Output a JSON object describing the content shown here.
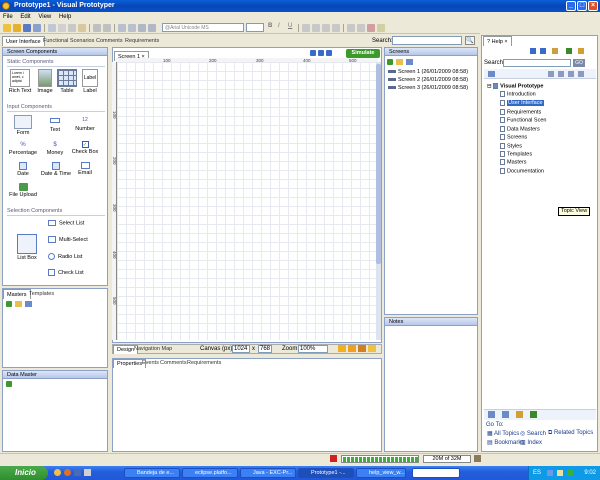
{
  "window": {
    "title": "Prototype1 - Visual Prototyper"
  },
  "menu": [
    "File",
    "Edit",
    "View",
    "Help"
  ],
  "toolbar": {
    "font_name": "@Arial Unicode MS",
    "bold": "B",
    "italic": "I",
    "underline": "U"
  },
  "top_tabs": [
    "User Interface",
    "Functional Scenarios",
    "Comments",
    "Requirements"
  ],
  "search": {
    "label": "Search:",
    "value": "",
    "button": "🔍"
  },
  "screen_components": {
    "title": "Screen Components",
    "static_title": "Static Components",
    "static": [
      {
        "label": "Rich Text",
        "preview": "Lorem i amet, c adipisi"
      },
      {
        "label": "Image"
      },
      {
        "label": "Table"
      },
      {
        "label": "Label",
        "preview": "Label"
      }
    ],
    "input_title": "Input Components",
    "inputs": [
      "Form",
      "Text",
      "Number",
      "Percentage",
      "Money",
      "Check Box",
      "Date",
      "Date & Time",
      "Email",
      "File Upload"
    ],
    "selection_title": "Selection Components",
    "selection": [
      "Select List",
      "Multi-Select",
      "List Box",
      "Radio List",
      "Check List"
    ]
  },
  "masters_tabs": [
    "Masters",
    "Templates"
  ],
  "data_master": {
    "title": "Data Master"
  },
  "canvas_tab": {
    "label": "Screen 1",
    "simulate": "Simulate"
  },
  "ruler": {
    "top": [
      "100",
      "200",
      "300",
      "400",
      "500"
    ],
    "left": [
      "100",
      "200",
      "300",
      "400",
      "500"
    ]
  },
  "design_bar": {
    "tabs": [
      "Design",
      "Navigation Map"
    ],
    "canvas_label": "Canvas (px):",
    "width": "1024",
    "times": "x",
    "height": "768",
    "zoom_label": "Zoom:",
    "zoom_value": "100%"
  },
  "properties_tabs": [
    "Properties",
    "Events",
    "Comments",
    "Requirements"
  ],
  "screens": {
    "title": "Screens",
    "items": [
      "Screen 1 (26/01/2009 08:58)",
      "Screen 2 (26/01/2009 08:58)",
      "Screen 3 (26/01/2009 08:58)"
    ]
  },
  "notes": {
    "title": "Notes"
  },
  "help": {
    "tab": "Help",
    "search_label": "Search:",
    "go": "GO",
    "tree_root": "Visual Prototype",
    "tree": [
      "Introduction",
      "User Interface",
      "Requirements",
      "Functional Scen",
      "Data Masters",
      "Screens",
      "Styles",
      "Templates",
      "Masters",
      "Documentation"
    ],
    "tooltip": "Topic View",
    "goto_label": "Go To:",
    "links": [
      "All Topics",
      "Search",
      "Related Topics",
      "Bookmarks",
      "Index"
    ]
  },
  "statusbar": {
    "memory": "20M of 32M"
  },
  "taskbar": {
    "start": "Inicio",
    "items": [
      "Bandeja de e...",
      "eclipse.platfo...",
      "Java - EXC-Pr...",
      "Prototype1 -...",
      "help_view_w..."
    ],
    "tray_lang": "ES",
    "clock": "9:02"
  },
  "colors": {
    "accent": "#0a5fd8",
    "simulate": "#3c9a2c",
    "taskbar": "#245edb"
  }
}
